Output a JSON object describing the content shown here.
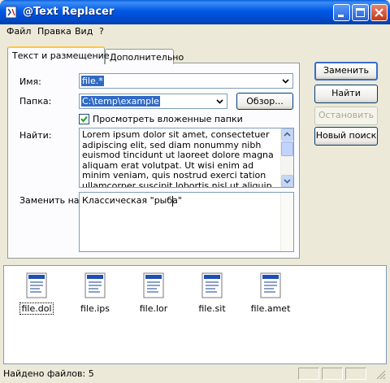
{
  "window": {
    "title": "@Text Replacer"
  },
  "menu": [
    "Файл",
    "Правка",
    "Вид",
    "?"
  ],
  "tabs": {
    "main": "Текст и размещение",
    "extra": "Дополнительно"
  },
  "form": {
    "name_label": "Имя:",
    "name_value": "file.*",
    "folder_label": "Папка:",
    "folder_value": "C:\\temp\\example",
    "browse_label": "Обзор...",
    "subfolders_label": "Просмотреть вложенные папки",
    "subfolders_checked": true,
    "find_label": "Найти:",
    "find_text": "Lorem ipsum dolor sit amet, consectetuer adipiscing elit, sed diam nonummy nibh euismod tincidunt ut laoreet dolore magna aliquam erat volutpat. Ut wisi enim ad minim veniam, quis nostrud exerci tation ullamcorper suscipit lobortis nisl ut aliquip ex ea",
    "replace_label": "Заменить на:",
    "replace_text": "Классическая \"рыба\""
  },
  "buttons": {
    "replace": "Заменить",
    "find": "Найти",
    "stop": "Остановить",
    "new_search": "Новый поиск"
  },
  "files": [
    {
      "name": "file.dol",
      "selected": true
    },
    {
      "name": "file.ips",
      "selected": false
    },
    {
      "name": "file.lor",
      "selected": false
    },
    {
      "name": "file.sit",
      "selected": false
    },
    {
      "name": "file.amet",
      "selected": false
    }
  ],
  "status": {
    "found_text": "Найдено файлов: 5"
  },
  "colors": {
    "titlebar": "#0058e6",
    "selection": "#316ac5",
    "face": "#ece9d8"
  }
}
